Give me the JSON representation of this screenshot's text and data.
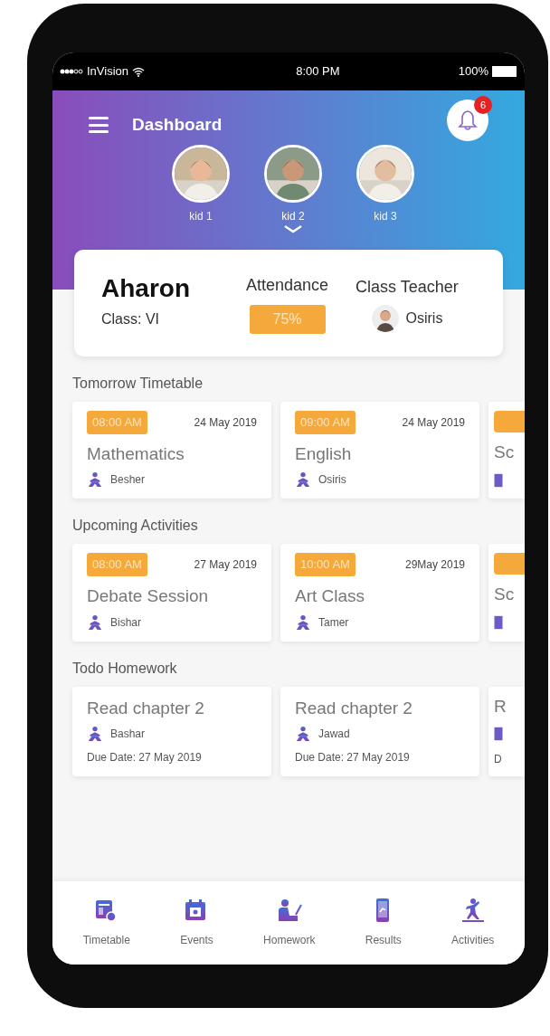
{
  "status_bar": {
    "carrier": "InVision",
    "time": "8:00 PM",
    "battery": "100%"
  },
  "header": {
    "title": "Dashboard",
    "notifications": "6"
  },
  "kids": [
    {
      "name": "kid 1",
      "selected": false
    },
    {
      "name": "kid 2",
      "selected": true
    },
    {
      "name": "kid 3",
      "selected": false
    }
  ],
  "student": {
    "name": "Aharon",
    "class": "Class: VI",
    "attendance_label": "Attendance",
    "attendance": "75%",
    "teacher_label": "Class Teacher",
    "teacher": "Osiris"
  },
  "sections": [
    {
      "title": "Tomorrow Timetable",
      "cards": [
        {
          "kind": "full",
          "time": "08:00 AM",
          "date": "24 May 2019",
          "title": "Mathematics",
          "teacher": "Besher"
        },
        {
          "kind": "full",
          "time": "09:00 AM",
          "date": "24 May 2019",
          "title": "English",
          "teacher": "Osiris"
        },
        {
          "kind": "partial",
          "title": "Sc",
          "timed": true
        }
      ]
    },
    {
      "title": "Upcoming Activities",
      "cards": [
        {
          "kind": "full",
          "time": "08:00 AM",
          "date": "27 May 2019",
          "title": "Debate Session",
          "teacher": "Bishar"
        },
        {
          "kind": "full",
          "time": "10:00 AM",
          "date": "29May 2019",
          "title": "Art Class",
          "teacher": "Tamer"
        },
        {
          "kind": "partial",
          "title": "Sc",
          "timed": true
        }
      ]
    },
    {
      "title": "Todo Homework",
      "cards": [
        {
          "kind": "full",
          "title": "Read chapter 2",
          "teacher": "Bashar",
          "due": "Due Date: 27 May 2019"
        },
        {
          "kind": "full",
          "title": "Read chapter 2",
          "teacher": "Jawad",
          "due": "Due Date: 27 May 2019"
        },
        {
          "kind": "partial",
          "title": "R",
          "due": "D",
          "timed": false
        }
      ]
    }
  ],
  "nav": [
    {
      "kind": "timetable",
      "label": "Timetable"
    },
    {
      "kind": "events",
      "label": "Events"
    },
    {
      "kind": "homework",
      "label": "Homework"
    },
    {
      "kind": "results",
      "label": "Results"
    },
    {
      "kind": "activities",
      "label": "Activities"
    }
  ]
}
